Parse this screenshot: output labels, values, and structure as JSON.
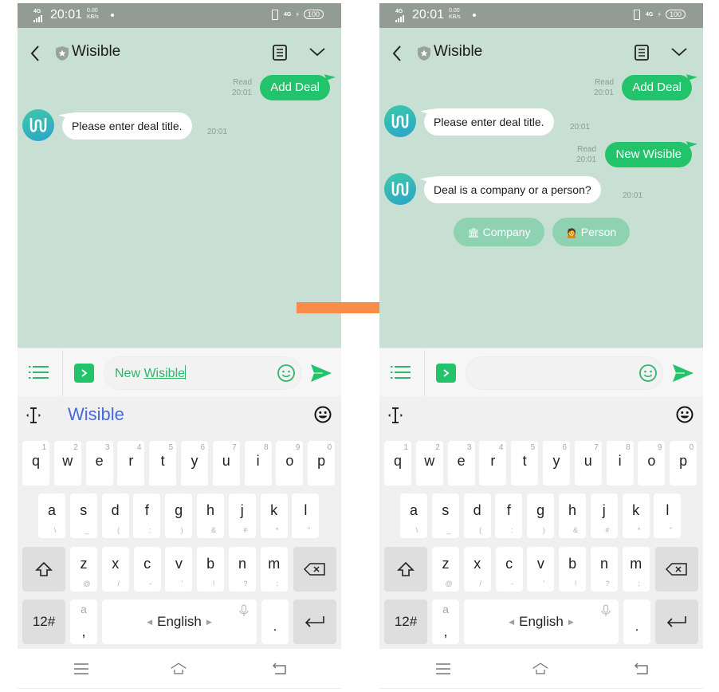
{
  "colors": {
    "status_bar": "#929c95",
    "chat_bg": "#c8dfd4",
    "accent_green": "#22c36b",
    "choice_chip": "#8fd2b1",
    "suggestion_blue": "#4869d6",
    "flow_arrow": "#fa8c4b"
  },
  "screens": [
    {
      "status_bar": {
        "network": "4G",
        "time": "20:01",
        "speed_value": "0.00",
        "speed_unit": "KB/s",
        "right_network": "4G",
        "battery": "100",
        "icons": [
          "signal-icon",
          "vibrate-icon",
          "charging-icon",
          "battery-icon"
        ]
      },
      "header": {
        "title": "Wisible",
        "icons": [
          "back-icon",
          "shield-star-icon",
          "notes-icon",
          "chevron-down-icon"
        ]
      },
      "messages": [
        {
          "direction": "out",
          "text": "Add Deal",
          "status": "Read",
          "time": "20:01"
        },
        {
          "direction": "in",
          "text": "Please enter deal title.",
          "time": "20:01"
        }
      ],
      "input": {
        "value_prefix": "New ",
        "value_composing": "Wisible",
        "placeholder": ""
      },
      "keyboard": {
        "suggestion": "Wisible"
      }
    },
    {
      "status_bar": {
        "network": "4G",
        "time": "20:01",
        "speed_value": "0.00",
        "speed_unit": "KB/s",
        "right_network": "4G",
        "battery": "100"
      },
      "header": {
        "title": "Wisible"
      },
      "messages": [
        {
          "direction": "out",
          "text": "Add Deal",
          "status": "Read",
          "time": "20:01"
        },
        {
          "direction": "in",
          "text": "Please enter deal title.",
          "time": "20:01"
        },
        {
          "direction": "out",
          "text": "New Wisible",
          "status": "Read",
          "time": "20:01"
        },
        {
          "direction": "in",
          "text": "Deal is a company or a person?",
          "time": "20:01"
        }
      ],
      "quick_replies": [
        {
          "emoji": "🏛",
          "label": "Company"
        },
        {
          "emoji": "🙍",
          "label": "Person"
        }
      ],
      "input": {
        "value": "",
        "placeholder": ""
      },
      "keyboard": {
        "suggestion": ""
      }
    }
  ],
  "keyboard": {
    "row1": [
      {
        "k": "q",
        "n": "1"
      },
      {
        "k": "w",
        "n": "2"
      },
      {
        "k": "e",
        "n": "3"
      },
      {
        "k": "r",
        "n": "4"
      },
      {
        "k": "t",
        "n": "5"
      },
      {
        "k": "y",
        "n": "6"
      },
      {
        "k": "u",
        "n": "7"
      },
      {
        "k": "i",
        "n": "8"
      },
      {
        "k": "o",
        "n": "9"
      },
      {
        "k": "p",
        "n": "0"
      }
    ],
    "row2": [
      {
        "k": "a",
        "s": "\\"
      },
      {
        "k": "s",
        "s": "_"
      },
      {
        "k": "d",
        "s": "("
      },
      {
        "k": "f",
        "s": ":"
      },
      {
        "k": "g",
        "s": ")"
      },
      {
        "k": "h",
        "s": "&"
      },
      {
        "k": "j",
        "s": "#"
      },
      {
        "k": "k",
        "s": "*"
      },
      {
        "k": "l",
        "s": "\""
      }
    ],
    "row3": [
      {
        "k": "z",
        "s": "@"
      },
      {
        "k": "x",
        "s": "/"
      },
      {
        "k": "c",
        "s": "-"
      },
      {
        "k": "v",
        "s": "'"
      },
      {
        "k": "b",
        "s": "!"
      },
      {
        "k": "n",
        "s": "?"
      },
      {
        "k": "m",
        "s": ";"
      }
    ],
    "numbers_key": "12#",
    "comma_key_top": "a",
    "comma_key": ",",
    "space_label": "English",
    "period_key": ".",
    "icons": [
      "shift-icon",
      "backspace-icon",
      "enter-icon",
      "microphone-icon",
      "cursor-icon",
      "emoji-icon"
    ]
  },
  "navbar": {
    "icons": [
      "menu-icon",
      "home-icon",
      "back-icon"
    ]
  }
}
